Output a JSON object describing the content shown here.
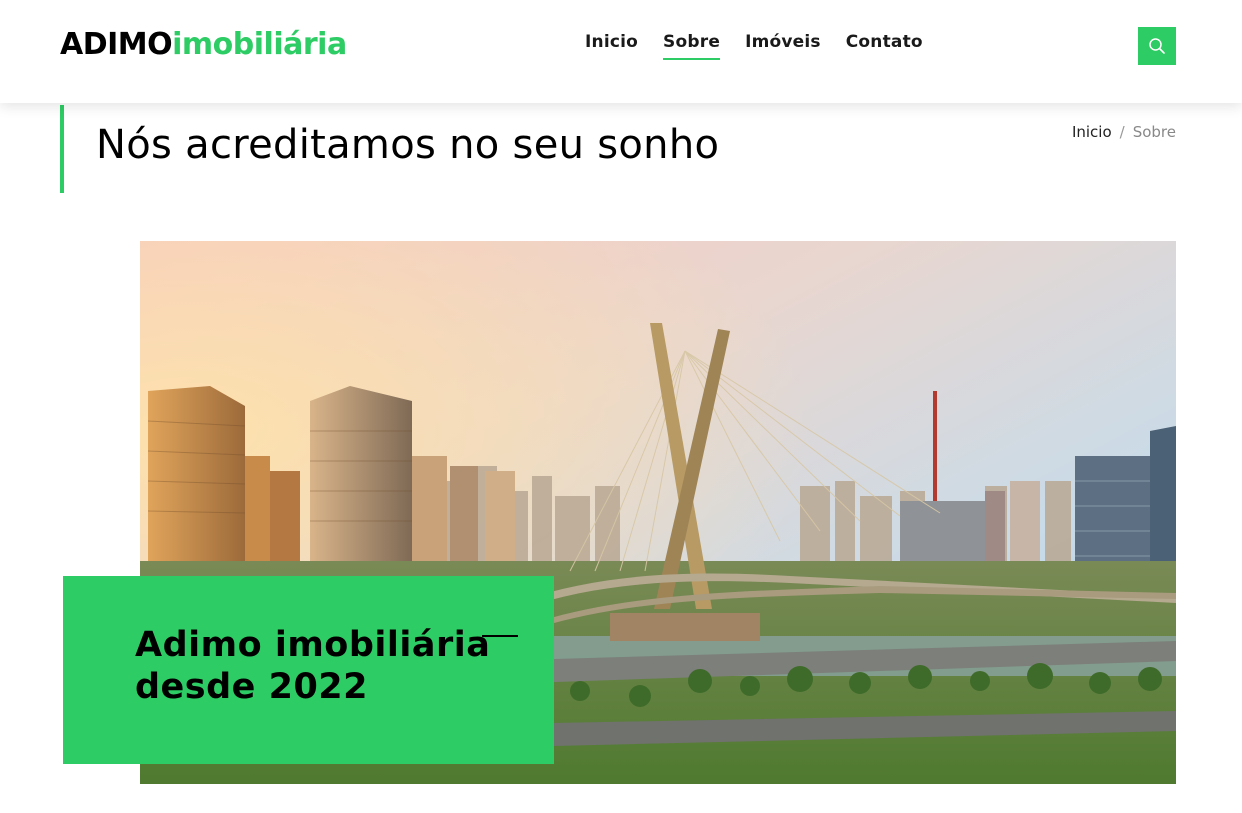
{
  "header": {
    "logo_part1": "ADIMO",
    "logo_part2": "imobiliária",
    "nav": [
      {
        "label": "Inicio"
      },
      {
        "label": "Sobre"
      },
      {
        "label": "Imóveis"
      },
      {
        "label": "Contato"
      }
    ],
    "search_icon": "search-icon"
  },
  "page": {
    "title": "Nós acreditamos no seu sonho",
    "breadcrumb": {
      "home": "Inicio",
      "separator": "/",
      "current": "Sobre"
    }
  },
  "hero": {
    "callout_line1": "Adimo imobiliária",
    "callout_line2": "desde 2022"
  },
  "colors": {
    "accent": "#2ecc64",
    "text": "#000000"
  }
}
